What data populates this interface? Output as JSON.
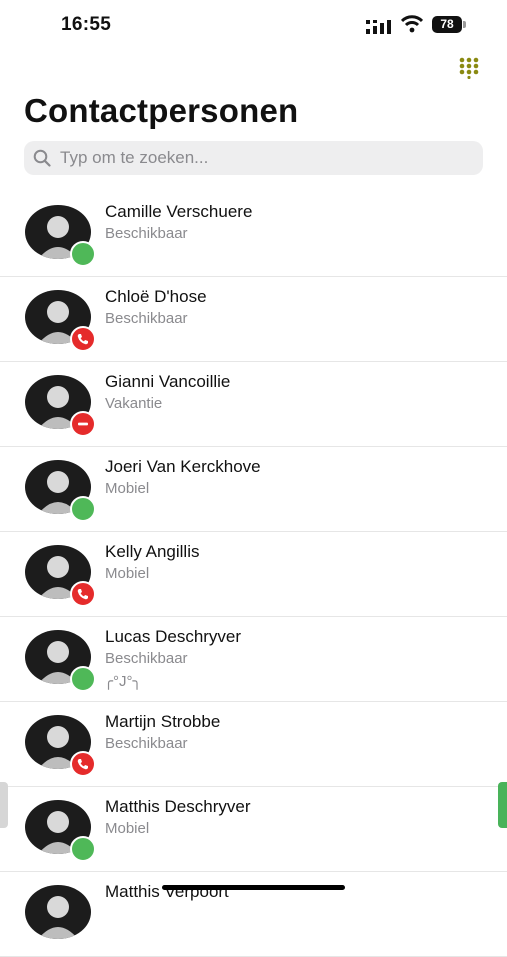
{
  "status_bar": {
    "time": "16:55",
    "battery": "78"
  },
  "header": {
    "title": "Contactpersonen",
    "dialpad_icon": "dialpad-icon",
    "accent_color": "#8a8a12"
  },
  "search": {
    "placeholder": "Typ om te zoeken...",
    "value": ""
  },
  "status_colors": {
    "available": "#4fb858",
    "busy": "#e52b2b"
  },
  "contacts": [
    {
      "name": "Camille Verschuere",
      "status": "Beschikbaar",
      "badge": "available",
      "badge_icon": "available-dot-icon"
    },
    {
      "name": "Chloë D'hose",
      "status": "Beschikbaar",
      "badge": "busy",
      "badge_icon": "phone-icon"
    },
    {
      "name": "Gianni Vancoillie",
      "status": "Vakantie",
      "badge": "busy",
      "badge_icon": "do-not-disturb-icon"
    },
    {
      "name": "Joeri Van Kerckhove",
      "status": "Mobiel",
      "badge": "available",
      "badge_icon": "available-dot-icon"
    },
    {
      "name": "Kelly Angillis",
      "status": "Mobiel",
      "badge": "busy",
      "badge_icon": "phone-icon"
    },
    {
      "name": "Lucas Deschryver",
      "status": "Beschikbaar",
      "note": "╭°J°╮",
      "badge": "available",
      "badge_icon": "available-dot-icon"
    },
    {
      "name": "Martijn Strobbe",
      "status": "Beschikbaar",
      "badge": "busy",
      "badge_icon": "phone-icon"
    },
    {
      "name": "Matthis Deschryver",
      "status": "Mobiel",
      "badge": "available",
      "badge_icon": "available-dot-icon"
    },
    {
      "name": "Matthis Verpoort"
    }
  ]
}
